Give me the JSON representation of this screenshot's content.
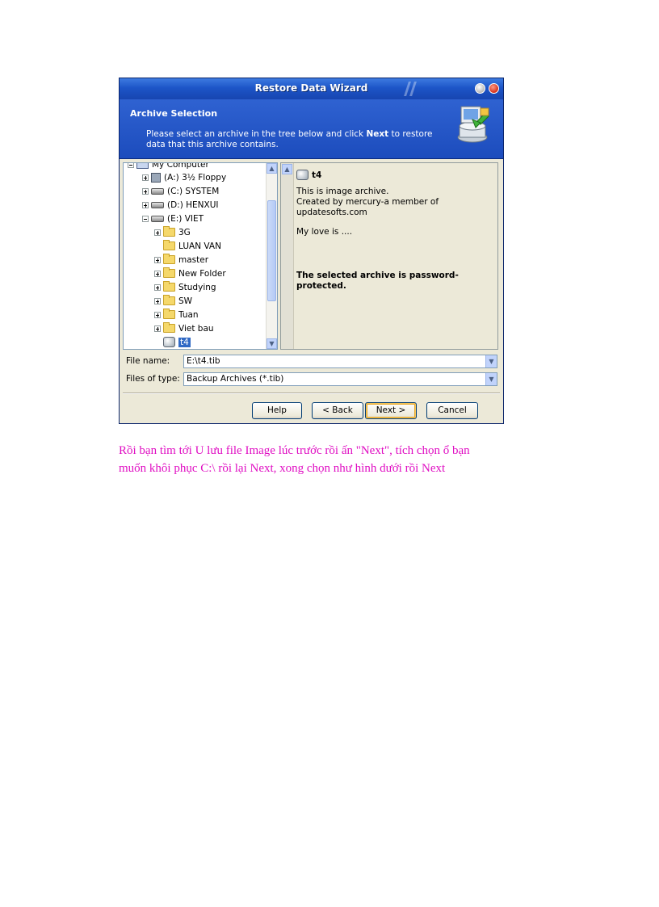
{
  "window": {
    "title": "Restore Data Wizard"
  },
  "header": {
    "title": "Archive Selection",
    "description_pre": "Please select an archive in the tree below and click ",
    "description_bold": "Next",
    "description_post": " to restore data that this archive contains."
  },
  "tree": {
    "items": [
      {
        "label": "My Computer",
        "icon": "computer-icon"
      },
      {
        "label": "(A:) 3½ Floppy",
        "icon": "floppy-icon"
      },
      {
        "label": "(C:) SYSTEM",
        "icon": "drive-icon"
      },
      {
        "label": "(D:) HENXUI",
        "icon": "drive-icon"
      },
      {
        "label": "(E:) VIET",
        "icon": "drive-icon"
      },
      {
        "label": "3G",
        "icon": "folder-icon"
      },
      {
        "label": "LUAN VAN",
        "icon": "folder-icon"
      },
      {
        "label": "master",
        "icon": "folder-icon"
      },
      {
        "label": "New Folder",
        "icon": "folder-icon"
      },
      {
        "label": "Studying",
        "icon": "folder-icon"
      },
      {
        "label": "SW",
        "icon": "folder-icon"
      },
      {
        "label": "Tuan",
        "icon": "folder-icon"
      },
      {
        "label": "Viet bau",
        "icon": "folder-icon"
      },
      {
        "label": "t4",
        "icon": "archive-icon",
        "selected": true
      }
    ]
  },
  "info": {
    "name": "t4",
    "line1": "This is image archive.",
    "line2": "Created by mercury-a member of",
    "line3": "updatesofts.com",
    "line4": "My love is ....",
    "warning1": "The selected archive is password-",
    "warning2": "protected."
  },
  "form": {
    "file_name_label": "File name:",
    "file_name_value": "E:\\t4.tib",
    "file_type_label": "Files of type:",
    "file_type_value": "Backup Archives (*.tib)"
  },
  "buttons": {
    "help": "Help",
    "back": "< Back",
    "next": "Next >",
    "cancel": "Cancel"
  },
  "caption": {
    "line1": "Rồi bạn tìm tới U lưu file Image lúc trước rồi ấn \"Next\", tích chọn ổ bạn",
    "line2": "muốn khôi phục C:\\ rồi lại Next, xong chọn như hình dưới rồi Next"
  }
}
